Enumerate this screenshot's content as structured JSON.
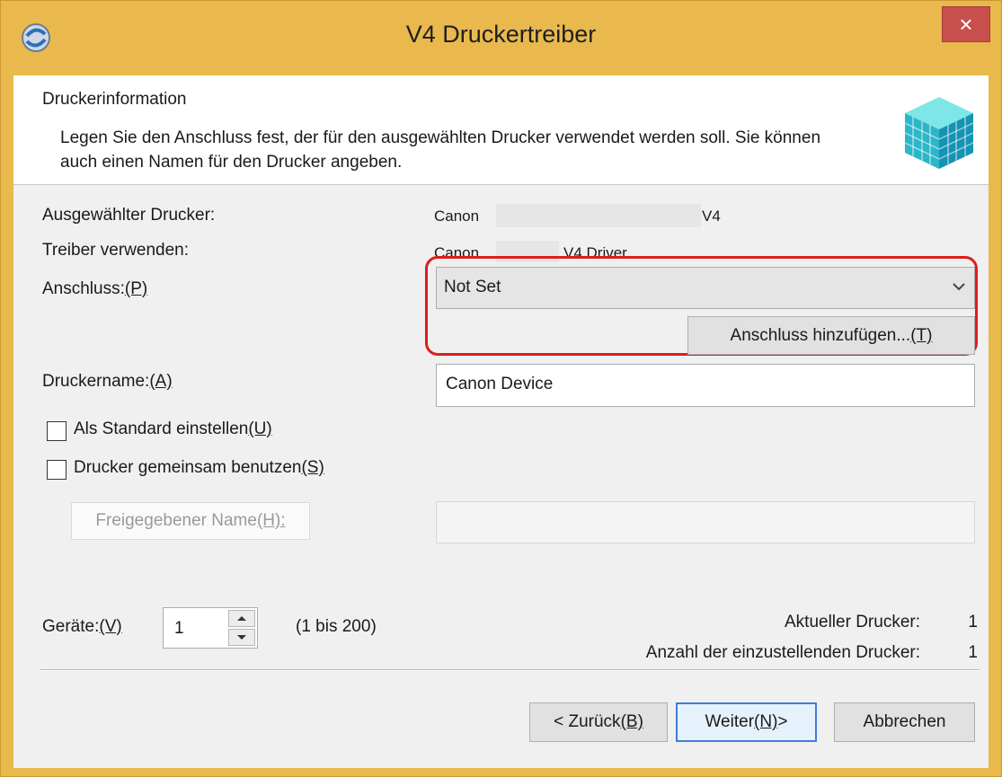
{
  "window": {
    "title": "V4 Druckertreiber",
    "close_glyph": "×"
  },
  "header": {
    "title": "Druckerinformation",
    "description": "Legen Sie den Anschluss fest, der für den ausgewählten Drucker verwendet werden soll. Sie können auch einen Namen für den Drucker angeben."
  },
  "info": {
    "selected_printer_label": "Ausgewählter Drucker:",
    "selected_printer_prefix": "Canon",
    "selected_printer_suffix": "V4",
    "driver_label": "Treiber verwenden:",
    "driver_prefix": "Canon",
    "driver_suffix": "V4 Driver"
  },
  "port": {
    "label": "Anschluss:",
    "label_key": "(P)",
    "selected": "Not Set",
    "add_button": "Anschluss hinzufügen...",
    "add_button_key": "(T)"
  },
  "printer_name": {
    "label": "Druckername:",
    "label_key": "(A)",
    "value": "Canon Device"
  },
  "options": {
    "default_label": "Als Standard einstellen",
    "default_key": "(U)",
    "default_checked": false,
    "share_label": "Drucker gemeinsam benutzen",
    "share_key": "(S)",
    "share_checked": false,
    "shared_name_label": "Freigegebener Name",
    "shared_name_key": "(H):",
    "shared_name_value": ""
  },
  "devices": {
    "label": "Geräte:",
    "label_key": "(V)",
    "value": "1",
    "range": "(1 bis 200)",
    "current_label": "Aktueller Drucker:",
    "current_value": "1",
    "count_label": "Anzahl der einzustellenden Drucker:",
    "count_value": "1"
  },
  "buttons": {
    "back": "< Zurück",
    "back_key": "(B)",
    "next": "Weiter",
    "next_key": "(N)",
    "next_suffix": " >",
    "cancel": "Abbrechen"
  },
  "colors": {
    "accent_frame": "#e9b94e",
    "close_button": "#c7504c",
    "highlight": "#e01c1c"
  }
}
